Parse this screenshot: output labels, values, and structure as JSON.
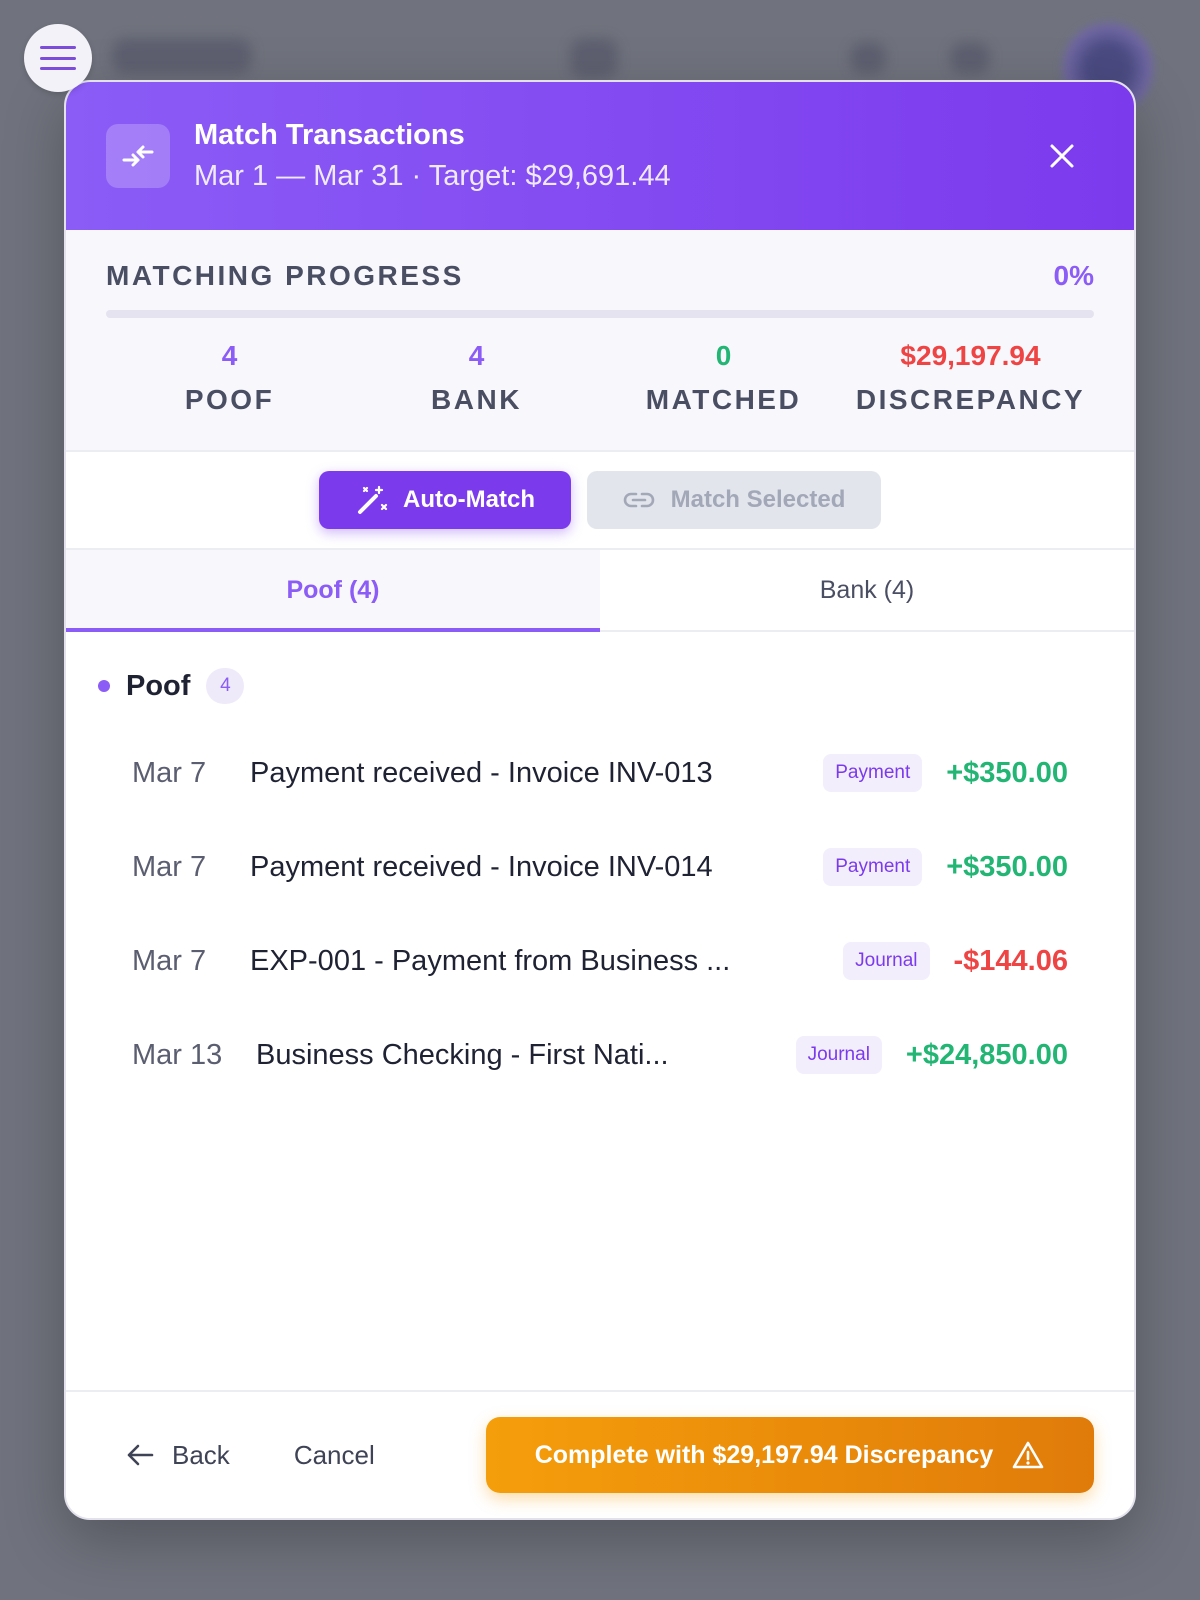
{
  "modal": {
    "title": "Match Transactions",
    "subtitle": "Mar 1 — Mar 31 · Target: $29,691.44"
  },
  "progress": {
    "label": "MATCHING PROGRESS",
    "percent_text": "0%",
    "percent": 0
  },
  "stats": [
    {
      "value": "4",
      "label": "POOF",
      "color": "#8b5cf6"
    },
    {
      "value": "4",
      "label": "BANK",
      "color": "#8b5cf6"
    },
    {
      "value": "0",
      "label": "MATCHED",
      "color": "#22b573"
    },
    {
      "value": "$29,197.94",
      "label": "DISCREPANCY",
      "color": "#ef4444"
    }
  ],
  "actions": {
    "auto_match": "Auto-Match",
    "match_selected": "Match Selected"
  },
  "tabs": [
    {
      "label": "Poof (4)",
      "active": true
    },
    {
      "label": "Bank (4)",
      "active": false
    }
  ],
  "group": {
    "name": "Poof",
    "count": "4"
  },
  "transactions": [
    {
      "date": "Mar 7",
      "description": "Payment received - Invoice INV-013",
      "tag": "Payment",
      "amount": "+$350.00",
      "sign": "pos"
    },
    {
      "date": "Mar 7",
      "description": "Payment received - Invoice INV-014",
      "tag": "Payment",
      "amount": "+$350.00",
      "sign": "pos"
    },
    {
      "date": "Mar 7",
      "description": "EXP-001 - Payment from Business ...",
      "tag": "Journal",
      "amount": "-$144.06",
      "sign": "neg"
    },
    {
      "date": "Mar 13",
      "description": "Business Checking - First Nati...",
      "tag": "Journal",
      "amount": "+$24,850.00",
      "sign": "pos"
    }
  ],
  "footer": {
    "back": "Back",
    "cancel": "Cancel",
    "complete": "Complete with $29,197.94 Discrepancy"
  },
  "colors": {
    "accent": "#7c3aed",
    "positive": "#22b573",
    "negative": "#ef4444",
    "warning": "#f59e0b"
  },
  "icons": {
    "menu": "menu-icon",
    "header": "swap-arrows-icon",
    "close": "close-icon",
    "auto_match": "magic-wand-icon",
    "match_selected": "link-icon",
    "back": "arrow-left-icon",
    "complete": "warning-triangle-icon"
  }
}
